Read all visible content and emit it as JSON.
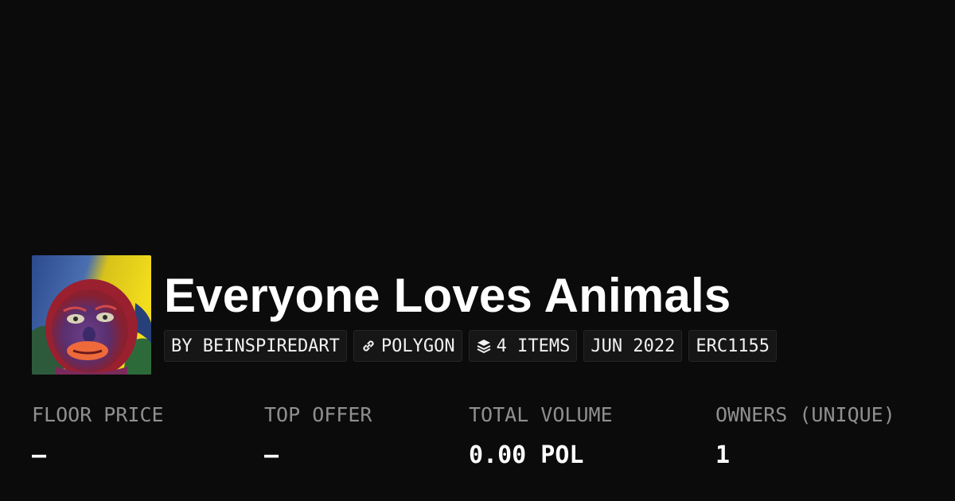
{
  "collection": {
    "name": "Everyone Loves Animals"
  },
  "tags": {
    "creator": "BY BEINSPIREDART",
    "chain": "POLYGON",
    "items": "4 ITEMS",
    "date": "JUN 2022",
    "standard": "ERC1155"
  },
  "icons": {
    "chain": "link-icon",
    "items": "layers-icon"
  },
  "stats": [
    {
      "label": "FLOOR PRICE",
      "value": "–"
    },
    {
      "label": "TOP OFFER",
      "value": "–"
    },
    {
      "label": "TOTAL VOLUME",
      "value": "0.00 POL"
    },
    {
      "label": "OWNERS (UNIQUE)",
      "value": "1"
    }
  ],
  "colors": {
    "background": "#0b0b0b",
    "tag_background": "#161616",
    "label": "#8f8f8f",
    "text": "#ffffff"
  }
}
